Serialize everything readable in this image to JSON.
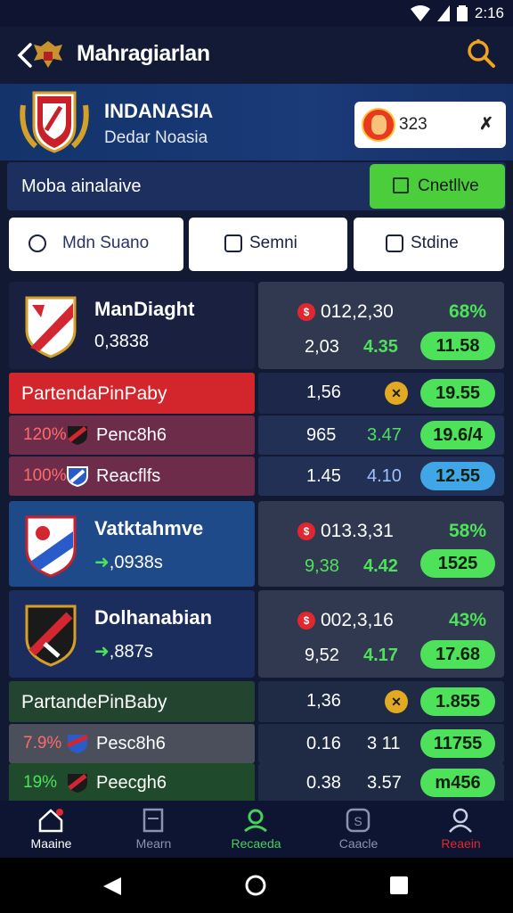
{
  "status": {
    "time": "2:16"
  },
  "appbar": {
    "title": "Mahragiarlan"
  },
  "hero": {
    "name": "INDANASIA",
    "subtitle": "Dedar Noasia",
    "user_value": "323"
  },
  "mobile": {
    "label": "Moba ainalaive",
    "button": "Cnetllve"
  },
  "tabs": [
    {
      "label": "Mdn Suano",
      "accent": "#e0282e"
    },
    {
      "label": "Semni"
    },
    {
      "label": "Stdine"
    }
  ],
  "rows": [
    {
      "name": "ManDiaght",
      "value": "0,3838",
      "odds_top": "012,2,30",
      "pct": "68%",
      "odds_a": "2,03",
      "odds_b": "4.35",
      "pill": "11.58"
    },
    {
      "name": "Vatktahmve",
      "value": ",0938s",
      "odds_top": "013.3,31",
      "pct": "58%",
      "odds_a": "9,38",
      "odds_b": "4.42",
      "pill": "1525"
    },
    {
      "name": "Dolhanabian",
      "value": ",887s",
      "odds_top": "002,3,16",
      "pct": "43%",
      "odds_a": "9,52",
      "odds_b": "4.17",
      "pill": "17.68"
    }
  ],
  "groups": [
    {
      "title": "PartendaPinPaby",
      "odds_a": "1,56",
      "pill": "19.55",
      "items": [
        {
          "pct": "120%",
          "name": "Penc8h6",
          "odds_a": "965",
          "odds_b": "3.47",
          "pill": "19.6/4"
        },
        {
          "pct": "100%",
          "name": "Reacflfs",
          "odds_a": "1.45",
          "odds_b": "4.10",
          "pill": "12.55"
        }
      ]
    },
    {
      "title": "PartandePinBaby",
      "odds_a": "1,36",
      "pill": "1.855",
      "items": [
        {
          "pct": "7.9%",
          "name": "Pesc8h6",
          "odds_a": "0.16",
          "odds_b": "3 11",
          "pill": "11755"
        },
        {
          "pct": "19%",
          "name": "Peecgh6",
          "odds_a": "0.38",
          "odds_b": "3.57",
          "pill": "m456"
        }
      ]
    }
  ],
  "bottomnav": [
    {
      "label": "Maaine",
      "icon": "home-icon",
      "color": "#ffffff"
    },
    {
      "label": "Mearn",
      "icon": "news-icon",
      "color": "#8a93b0"
    },
    {
      "label": "Recaeda",
      "icon": "user-location-icon",
      "color": "#46d15c"
    },
    {
      "label": "Caacle",
      "icon": "cash-icon",
      "color": "#8a93b0"
    },
    {
      "label": "Reaein",
      "icon": "profile-icon",
      "color": "#e0282e"
    }
  ]
}
